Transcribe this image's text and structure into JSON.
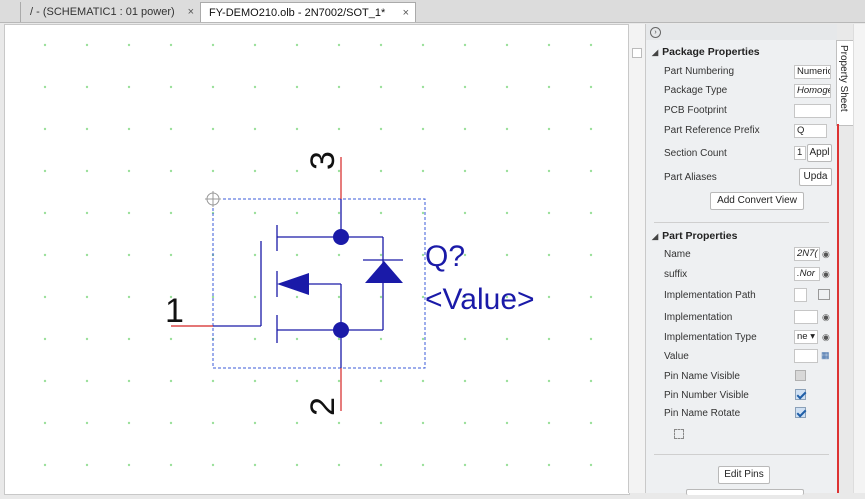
{
  "tabs": [
    {
      "label": "/ - (SCHEMATIC1 : 01 power)",
      "close": "×"
    },
    {
      "label": "FY-DEMO210.olb - 2N7002/SOT_1*",
      "close": "×"
    }
  ],
  "schematic": {
    "pin_labels": [
      "1",
      "2",
      "3"
    ],
    "ref_label": "Q?",
    "value_label": "<Value>",
    "colors": {
      "wire": "#d42525",
      "body": "#1a1aa8",
      "dots": "#9be09b",
      "bbox": "#3b5bd8"
    }
  },
  "sidetab": {
    "label": "Property Sheet"
  },
  "package_properties": {
    "header": "Package Properties",
    "part_numbering_label": "Part Numbering",
    "part_numbering_value": "Numeric",
    "package_type_label": "Package Type",
    "package_type_value": "Homoge",
    "pcb_footprint_label": "PCB Footprint",
    "pcb_footprint_value": "",
    "ref_prefix_label": "Part Reference Prefix",
    "ref_prefix_value": "Q",
    "section_count_label": "Section Count",
    "section_count_value": "1",
    "apply_label": "Appl",
    "part_aliases_label": "Part Aliases",
    "update_label": "Upda",
    "add_convert_view_label": "Add Convert View"
  },
  "part_properties": {
    "header": "Part Properties",
    "name_label": "Name",
    "name_value": "2N7(",
    "suffix_label": "suffix",
    "suffix_value": ".Nor",
    "impl_path_label": "Implementation Path",
    "impl_path_value": "",
    "impl_label": "Implementation",
    "impl_value": "",
    "impl_type_label": "Implementation Type",
    "impl_type_value": "ne",
    "value_label": "Value",
    "value_value": "",
    "pin_name_visible_label": "Pin Name Visible",
    "pin_name_visible": false,
    "pin_number_visible_label": "Pin Number Visible",
    "pin_number_visible": true,
    "pin_name_rotate_label": "Pin Name Rotate",
    "pin_name_rotate": true,
    "edit_pins_label": "Edit Pins"
  }
}
